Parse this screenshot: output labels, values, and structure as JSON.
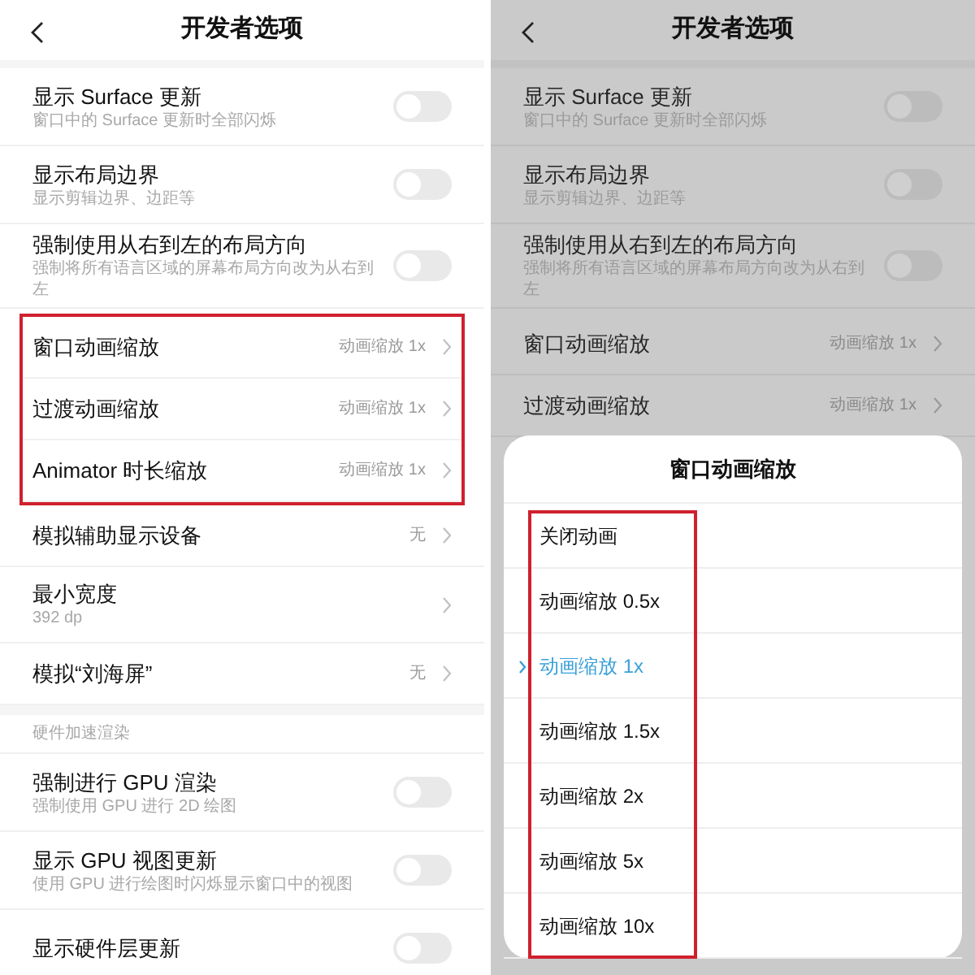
{
  "left": {
    "header": {
      "title": "开发者选项"
    },
    "blocks": [
      {
        "highlighted": false,
        "rows": [
          {
            "kind": "toggle",
            "title": "显示 Surface 更新",
            "subtitle": "窗口中的 Surface 更新时全部闪烁",
            "on": false
          },
          {
            "kind": "toggle",
            "title": "显示布局边界",
            "subtitle": "显示剪辑边界、边距等",
            "on": false
          },
          {
            "kind": "toggle",
            "title": "强制使用从右到左的布局方向",
            "subtitle": "强制将所有语言区域的屏幕布局方向改为从右到左",
            "on": false
          }
        ]
      },
      {
        "highlighted": true,
        "rows": [
          {
            "kind": "link",
            "title": "窗口动画缩放",
            "value": "动画缩放 1x"
          },
          {
            "kind": "link",
            "title": "过渡动画缩放",
            "value": "动画缩放 1x"
          },
          {
            "kind": "link",
            "title": "Animator 时长缩放",
            "value": "动画缩放 1x"
          }
        ]
      },
      {
        "highlighted": false,
        "rows": [
          {
            "kind": "link",
            "title": "模拟辅助显示设备",
            "value": "无"
          },
          {
            "kind": "link",
            "title": "最小宽度",
            "subtitle": "392 dp"
          },
          {
            "kind": "link",
            "title": "模拟“刘海屏”",
            "value": "无"
          },
          {
            "kind": "section",
            "title": "硬件加速渲染"
          },
          {
            "kind": "toggle",
            "title": "强制进行 GPU 渲染",
            "subtitle": "强制使用 GPU 进行 2D 绘图",
            "on": false
          },
          {
            "kind": "toggle",
            "title": "显示 GPU 视图更新",
            "subtitle": "使用 GPU 进行绘图时闪烁显示窗口中的视图",
            "on": false
          },
          {
            "kind": "toggle",
            "title": "显示硬件层更新",
            "on": false
          }
        ]
      }
    ]
  },
  "right": {
    "header": {
      "title": "开发者选项"
    },
    "rows": [
      {
        "kind": "toggle",
        "title": "显示 Surface 更新",
        "subtitle": "窗口中的 Surface 更新时全部闪烁",
        "on": false
      },
      {
        "kind": "toggle",
        "title": "显示布局边界",
        "subtitle": "显示剪辑边界、边距等",
        "on": false
      },
      {
        "kind": "toggle",
        "title": "强制使用从右到左的布局方向",
        "subtitle": "强制将所有语言区域的屏幕布局方向改为从右到左",
        "on": false
      },
      {
        "kind": "link",
        "title": "窗口动画缩放",
        "value": "动画缩放 1x"
      },
      {
        "kind": "link",
        "title": "过渡动画缩放",
        "value": "动画缩放 1x"
      }
    ],
    "sheet": {
      "title": "窗口动画缩放",
      "highlighted": true,
      "options": [
        {
          "label": "关闭动画",
          "selected": false
        },
        {
          "label": "动画缩放 0.5x",
          "selected": false
        },
        {
          "label": "动画缩放 1x",
          "selected": true
        },
        {
          "label": "动画缩放 1.5x",
          "selected": false
        },
        {
          "label": "动画缩放 2x",
          "selected": false
        },
        {
          "label": "动画缩放 5x",
          "selected": false
        },
        {
          "label": "动画缩放 10x",
          "selected": false
        }
      ]
    }
  }
}
